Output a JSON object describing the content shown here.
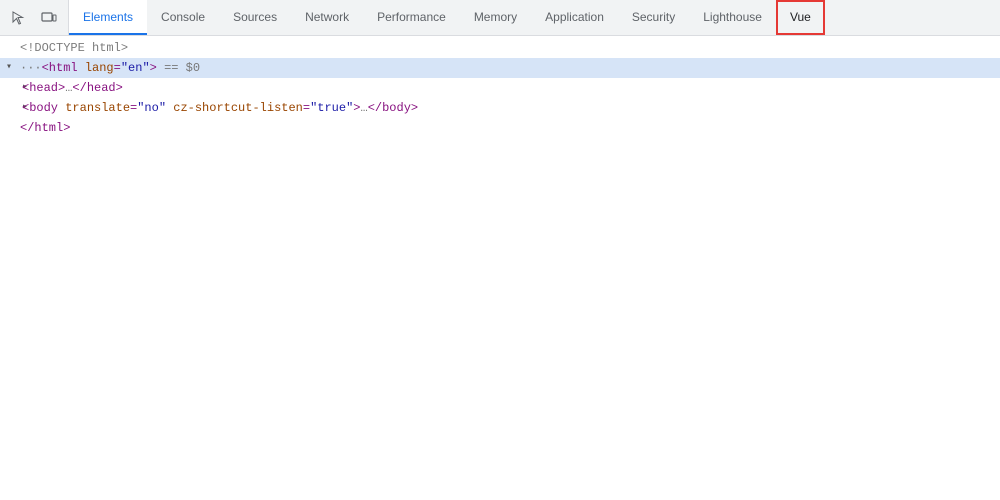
{
  "tabs": [
    {
      "id": "elements",
      "label": "Elements",
      "active": true,
      "vue": false
    },
    {
      "id": "console",
      "label": "Console",
      "active": false,
      "vue": false
    },
    {
      "id": "sources",
      "label": "Sources",
      "active": false,
      "vue": false
    },
    {
      "id": "network",
      "label": "Network",
      "active": false,
      "vue": false
    },
    {
      "id": "performance",
      "label": "Performance",
      "active": false,
      "vue": false
    },
    {
      "id": "memory",
      "label": "Memory",
      "active": false,
      "vue": false
    },
    {
      "id": "application",
      "label": "Application",
      "active": false,
      "vue": false
    },
    {
      "id": "security",
      "label": "Security",
      "active": false,
      "vue": false
    },
    {
      "id": "lighthouse",
      "label": "Lighthouse",
      "active": false,
      "vue": false
    },
    {
      "id": "vue",
      "label": "Vue",
      "active": false,
      "vue": true
    }
  ],
  "toolbar": {
    "select_icon": "⊡",
    "device_icon": "▭"
  },
  "dom": {
    "line1": "<!DOCTYPE html>",
    "line2_prefix": "▾",
    "line2_tag_open": "<html",
    "line2_attr1_name": "lang",
    "line2_attr1_value": "\"en\"",
    "line2_suffix": " == $0",
    "line3_prefix": "▸",
    "line3_tag": "<head>…</head>",
    "line4_prefix": "▸",
    "line4_tag_open": "<body",
    "line4_attr1_name": "translate",
    "line4_attr1_value": "\"no\"",
    "line4_attr2_name": "cz-shortcut-listen",
    "line4_attr2_value": "\"true\"",
    "line4_suffix": ">…</body>",
    "line5": "</html>"
  }
}
